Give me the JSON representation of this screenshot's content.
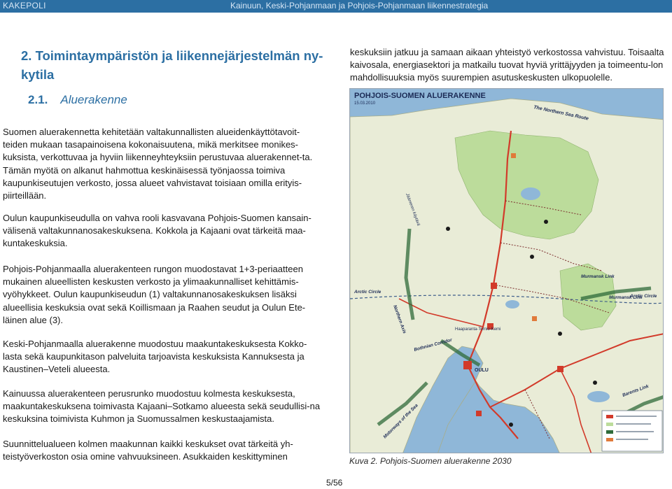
{
  "header": {
    "left": "KAKEPOLI",
    "right": "Kainuun, Keski-Pohjanmaan ja Pohjois-Pohjanmaan liikennestrategia"
  },
  "section": {
    "title": "2. Toimintaympäristön ja liikennejärjestelmän ny-kytila",
    "subsection_number": "2.1.",
    "subsection_title": "Aluerakenne"
  },
  "paragraphs": [
    "Suomen aluerakennetta kehitetään valtakunnallisten alueidenkäyttötavoit-teiden mukaan tasapainoisena kokonaisuutena, mikä merkitsee monikes-kuksista, verkottuvaa ja hyviin liikenneyhteyksiin perustuvaa aluerakennet-ta. Tämän myötä on alkanut hahmottua keskinäisessä työnjaossa toimiva kaupunkiseutujen verkosto, jossa alueet vahvistavat toisiaan omilla erityis-piirteillään.",
    "Oulun kaupunkiseudulla on vahva rooli kasvavana Pohjois-Suomen kansain-välisenä valtakunnanosakeskuksena. Kokkola ja Kajaani ovat tärkeitä maa-kuntakeskuksia.",
    "Pohjois-Pohjanmaalla aluerakenteen rungon muodostavat 1+3-periaatteen mukainen alueellisten keskusten verkosto ja ylimaakunnalliset kehittämis-vyöhykkeet. Oulun kaupunkiseudun (1) valtakunnanosakeskuksen lisäksi alueellisia keskuksia ovat sekä Koillismaan ja Raahen seudut ja Oulun Ete-läinen alue (3).",
    "Keski-Pohjanmaalla aluerakenne muodostuu maakuntakeskuksesta Kokko-lasta sekä kaupunkitason palveluita tarjoavista keskuksista Kannuksesta ja Kaustinen–Veteli alueesta.",
    "Kainuussa aluerakenteen perusrunko muodostuu kolmesta keskuksesta, maakuntakeskuksena toimivasta Kajaani–Sotkamo alueesta sekä seudullisi-na keskuksina toimivista Kuhmon ja Suomussalmen keskustaajamista.",
    "Suunnittelualueen kolmen maakunnan kaikki keskukset ovat tärkeitä yh-teistyöverkoston osia omine vahvuuksineen. Asukkaiden keskittyminen"
  ],
  "right_paragraph": "keskuksiin jatkuu ja samaan aikaan yhteistyö verkostossa vahvistuu. Toisaalta kaivosala, energiasektori ja matkailu tuovat hyviä yrittäjyyden ja toimeentu-lon mahdollisuuksia myös suurempien asutuskeskusten ulkopuolelle.",
  "map": {
    "title": "POHJOIS-SUOMEN ALUERAKENNE",
    "date": "15.03.2010",
    "labels": {
      "northern_sea_route": "The Northern Sea Route",
      "jaameren": "Jäämeren käytävä",
      "murmansk_1": "Murmansk Link",
      "murmansk_2": "Murmansk Link",
      "arctic_circle_w": "Arctic Circle",
      "arctic_circle_e": "Arctic Circle",
      "northern_axis": "Northern Axis",
      "haparanda": "Haaparanta-Tornio-Kemi",
      "bothnian": "Bothnian Corridor",
      "oulu": "OULU",
      "motorways": "Motorways of the Sea",
      "barents": "Barents Link"
    }
  },
  "caption": "Kuva 2. Pohjois-Suomen aluerakenne 2030",
  "page_number": "5/56",
  "colors": {
    "header_bg": "#2c6fa3",
    "heading": "#2c6fa3",
    "sea": "#8fb7d8",
    "land": "#e9ecd7",
    "green_area": "#bcdc9b",
    "main_road": "#d23a2a",
    "route_arrow": "#2f6b3a"
  }
}
